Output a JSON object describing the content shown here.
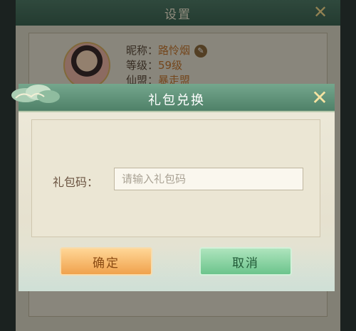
{
  "settings": {
    "title": "设置",
    "nickname_label": "昵称：",
    "nickname": "路怜烟",
    "level_label": "等级：",
    "level": "59级",
    "guild_label": "仙盟：",
    "guild": "暴走盟"
  },
  "dialog": {
    "title": "礼包兑换",
    "code_label": "礼包码：",
    "code_placeholder": "请输入礼包码",
    "confirm_label": "确定",
    "cancel_label": "取消"
  },
  "icons": {
    "close": "close-icon",
    "edit": "pencil-icon",
    "cloud": "cloud-ornament-icon"
  },
  "colors": {
    "header_green": "#5f9178",
    "confirm_orange": "#f0a24d",
    "cancel_green": "#6cc48c",
    "value_orange": "#c2762f"
  }
}
